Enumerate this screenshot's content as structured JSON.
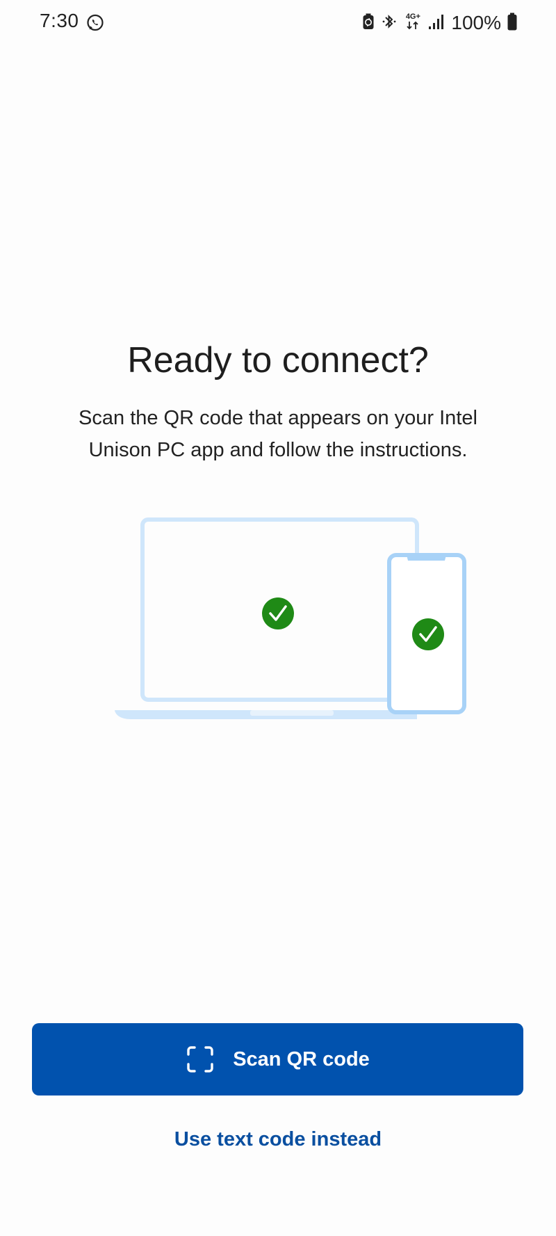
{
  "status_bar": {
    "time": "7:30",
    "left_icon": "whatsapp-icon",
    "right_icons": [
      "battery-saver-icon",
      "bluetooth-icon",
      "network-4g-plus-icon",
      "signal-icon",
      "battery-icon"
    ],
    "network_label": "4G+",
    "battery_percent": "100%"
  },
  "main": {
    "title": "Ready to connect?",
    "description": "Scan the QR code that appears on your Intel Unison PC app and follow the instructions.",
    "illustration": {
      "icons": [
        "laptop-icon",
        "phone-icon",
        "check-icon"
      ],
      "check_color": "#1f8a16",
      "device_outline_color": "#cfe6fb",
      "phone_outline_color": "#a8d2f7"
    }
  },
  "actions": {
    "scan_button_label": "Scan QR code",
    "scan_button_icon": "qr-scan-icon",
    "text_code_link": "Use text code instead"
  },
  "colors": {
    "primary": "#0152ae",
    "link": "#0a4fa0",
    "background": "#fdfdfd"
  }
}
